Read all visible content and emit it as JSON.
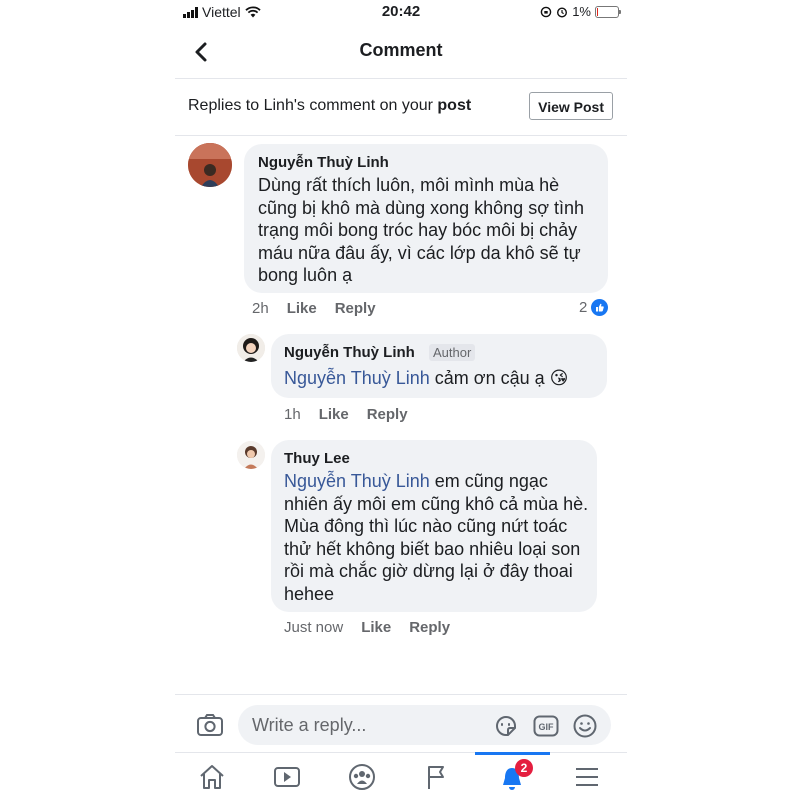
{
  "status_bar": {
    "carrier": "Viettel",
    "time": "20:42",
    "battery": "1%",
    "battery_level": 0.01
  },
  "nav": {
    "title": "Comment"
  },
  "context": {
    "prefix": "Replies to Linh's comment on your ",
    "emphasis": "post",
    "view_post_label": "View Post"
  },
  "comments": [
    {
      "name": "Nguyễn Thuỳ Linh",
      "text": "Dùng rất thích luôn, môi mình mùa hè cũng bị khô mà dùng xong không sợ tình trạng môi bong tróc hay bóc môi bị chảy máu nữa đâu ấy, vì các lớp da khô sẽ tự bong luôn ạ",
      "time": "2h",
      "like_label": "Like",
      "reply_label": "Reply",
      "reaction_count": "2"
    },
    {
      "name": "Nguyễn Thuỳ Linh",
      "badge": "Author",
      "mention": "Nguyễn Thuỳ Linh",
      "text": " cảm ơn cậu ạ 😘",
      "time": "1h",
      "like_label": "Like",
      "reply_label": "Reply"
    },
    {
      "name": "Thuy Lee",
      "mention": "Nguyễn Thuỳ Linh",
      "text": "  em cũng ngạc nhiên ấy môi em cũng khô cả mùa hè. Mùa đông thì lúc nào cũng nứt toác thử hết không biết bao nhiêu loại son rồi mà chắc giờ dừng lại ở đây thoai hehee",
      "time": "Just now",
      "like_label": "Like",
      "reply_label": "Reply"
    }
  ],
  "composer": {
    "placeholder": "Write a reply...",
    "gif_label": "GIF"
  },
  "tabbar": {
    "items": [
      "home-icon",
      "video-icon",
      "groups-icon",
      "pages-flag-icon",
      "notifications-icon",
      "menu-icon"
    ],
    "active": "notifications-icon",
    "notification_count": "2",
    "accent": "#1877f2"
  }
}
